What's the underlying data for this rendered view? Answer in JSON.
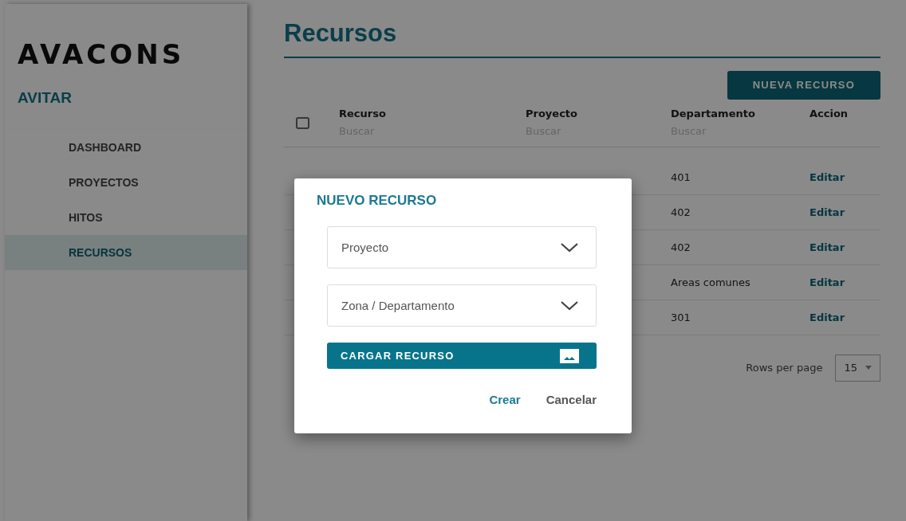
{
  "sidebar": {
    "logo": "AVACONS",
    "subtitle": "AVITAR",
    "items": [
      {
        "label": "DASHBOARD",
        "selected": false
      },
      {
        "label": "PROYECTOS",
        "selected": false
      },
      {
        "label": "HITOS",
        "selected": false
      },
      {
        "label": "RECURSOS",
        "selected": true
      }
    ]
  },
  "page": {
    "title": "Recursos",
    "new_button": "NUEVA RECURSO"
  },
  "table": {
    "select_all_checked": false,
    "columns": [
      {
        "label": "Recurso",
        "placeholder": "Buscar"
      },
      {
        "label": "Proyecto",
        "placeholder": "Buscar"
      },
      {
        "label": "Departamento",
        "placeholder": "Buscar"
      },
      {
        "label": "Accion"
      }
    ],
    "rows": [
      {
        "departamento": "401",
        "action": "Editar"
      },
      {
        "departamento": "402",
        "action": "Editar"
      },
      {
        "departamento": "402",
        "action": "Editar"
      },
      {
        "departamento": "Areas comunes",
        "action": "Editar"
      },
      {
        "departamento": "301",
        "action": "Editar"
      }
    ]
  },
  "pagination": {
    "rows_per_page_label": "Rows per page",
    "rows_per_page": "15"
  },
  "modal": {
    "title": "NUEVO RECURSO",
    "selects": [
      {
        "placeholder": "Proyecto"
      },
      {
        "placeholder": "Zona / Departamento"
      }
    ],
    "upload_button": "CARGAR RECURSO",
    "actions": [
      {
        "label": "Crear",
        "kind": "primary"
      },
      {
        "label": "Cancelar",
        "kind": "secondary"
      }
    ]
  }
}
